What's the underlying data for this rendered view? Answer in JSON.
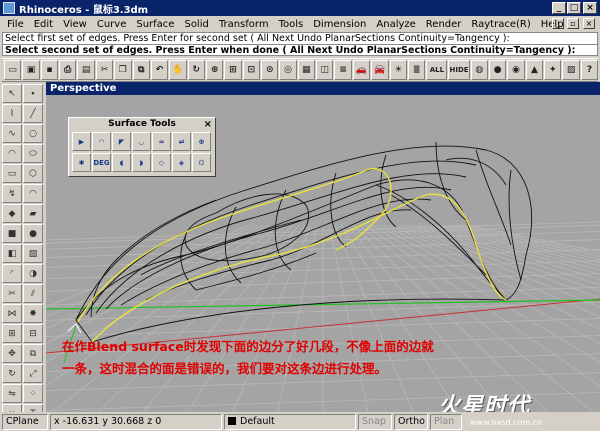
{
  "window": {
    "title": "Rhinoceros - 鼠标3.3dm",
    "min": "_",
    "max": "□",
    "close": "×"
  },
  "menu": [
    "File",
    "Edit",
    "View",
    "Curve",
    "Surface",
    "Solid",
    "Transform",
    "Tools",
    "Dimension",
    "Analyze",
    "Render",
    "Raytrace(R)",
    "Help"
  ],
  "command": {
    "history": "Select first set of edges. Press Enter for second set ( All Next Undo PlanarSections Continuity=Tangency ):",
    "prompt": "Select second set of edges. Press Enter when done ( All Next Undo PlanarSections Continuity=Tangency ):"
  },
  "toolbar_items": [
    {
      "name": "new-icon",
      "glyph": "▭"
    },
    {
      "name": "open-icon",
      "glyph": "▣"
    },
    {
      "name": "save-icon",
      "glyph": "▪"
    },
    {
      "name": "print-icon",
      "glyph": "⎙"
    },
    {
      "name": "paste-icon",
      "glyph": "▤"
    },
    {
      "name": "cut-icon",
      "glyph": "✂"
    },
    {
      "name": "copy-icon",
      "glyph": "❐"
    },
    {
      "name": "copy2-icon",
      "glyph": "⧉"
    },
    {
      "name": "undo-icon",
      "glyph": "↶"
    },
    {
      "name": "pan-icon",
      "glyph": "✋"
    },
    {
      "name": "rotate-view-icon",
      "glyph": "↻"
    },
    {
      "name": "zoom-icon",
      "glyph": "⊕"
    },
    {
      "name": "zoom-window-icon",
      "glyph": "⊞"
    },
    {
      "name": "zoom-extents-icon",
      "glyph": "⊡"
    },
    {
      "name": "zoom-selected-icon",
      "glyph": "⊙"
    },
    {
      "name": "zoom-target-icon",
      "glyph": "◎"
    },
    {
      "name": "grid-icon",
      "glyph": "▦"
    },
    {
      "name": "view-cube-icon",
      "glyph": "◫"
    },
    {
      "name": "layers-icon",
      "glyph": "≡"
    },
    {
      "name": "car-icon",
      "glyph": "🚗"
    },
    {
      "name": "car-red-icon",
      "glyph": "🚘"
    },
    {
      "name": "light-icon",
      "glyph": "☀"
    },
    {
      "name": "object-props-icon",
      "glyph": "≣"
    },
    {
      "name": "show-all-icon",
      "glyph": "ALL"
    },
    {
      "name": "hide-icon",
      "glyph": "HIDE"
    },
    {
      "name": "color-wheel-icon",
      "glyph": "◍"
    },
    {
      "name": "sphere-gray-icon",
      "glyph": "●"
    },
    {
      "name": "sphere-shaded-icon",
      "glyph": "◉"
    },
    {
      "name": "cone-blue-icon",
      "glyph": "▲"
    },
    {
      "name": "render-icon",
      "glyph": "✦"
    },
    {
      "name": "options-icon",
      "glyph": "▨"
    },
    {
      "name": "help-icon",
      "glyph": "?"
    }
  ],
  "left_tools": [
    {
      "name": "select-arrow-icon",
      "glyph": "↖"
    },
    {
      "name": "point-icon",
      "glyph": "∙"
    },
    {
      "name": "polyline-icon",
      "glyph": "⌇"
    },
    {
      "name": "line-icon",
      "glyph": "╱"
    },
    {
      "name": "curve-icon",
      "glyph": "∿"
    },
    {
      "name": "circle-icon",
      "glyph": "○"
    },
    {
      "name": "arc-icon",
      "glyph": "◠"
    },
    {
      "name": "ellipse-icon",
      "glyph": "⬭"
    },
    {
      "name": "rectangle-icon",
      "glyph": "▭"
    },
    {
      "name": "polygon-icon",
      "glyph": "⬡"
    },
    {
      "name": "freeform-icon",
      "glyph": "↯"
    },
    {
      "name": "offset-icon",
      "glyph": "◠"
    },
    {
      "name": "surface-icon",
      "glyph": "◆"
    },
    {
      "name": "extrude-icon",
      "glyph": "▰"
    },
    {
      "name": "box-icon",
      "glyph": "■"
    },
    {
      "name": "sphere-icon",
      "glyph": "●"
    },
    {
      "name": "cylinder-icon",
      "glyph": "◧"
    },
    {
      "name": "mesh-icon",
      "glyph": "▧"
    },
    {
      "name": "fillet-icon",
      "glyph": "◜"
    },
    {
      "name": "boolean-icon",
      "glyph": "◑"
    },
    {
      "name": "trim-icon",
      "glyph": "✂"
    },
    {
      "name": "split-icon",
      "glyph": "⫽"
    },
    {
      "name": "join-icon",
      "glyph": "⋈"
    },
    {
      "name": "explode-icon",
      "glyph": "✸"
    },
    {
      "name": "group-icon",
      "glyph": "⊞"
    },
    {
      "name": "ungroup-icon",
      "glyph": "⊟"
    },
    {
      "name": "move-icon",
      "glyph": "✥"
    },
    {
      "name": "copy-move-icon",
      "glyph": "⧉"
    },
    {
      "name": "rotate-icon",
      "glyph": "↻"
    },
    {
      "name": "scale-icon",
      "glyph": "⤢"
    },
    {
      "name": "mirror-icon",
      "glyph": "⇋"
    },
    {
      "name": "array-icon",
      "glyph": "⁘"
    },
    {
      "name": "dimension-icon",
      "glyph": "↔"
    },
    {
      "name": "text-icon",
      "glyph": "T"
    },
    {
      "name": "properties-icon",
      "glyph": "≣"
    },
    {
      "name": "analyze-icon",
      "glyph": "⌖"
    }
  ],
  "viewport": {
    "title": "Perspective"
  },
  "surface_tools": {
    "title": "Surface Tools",
    "close": "×",
    "row1": [
      {
        "name": "extend-surface-icon",
        "glyph": "▶"
      },
      {
        "name": "fillet-surface-icon",
        "glyph": "◠"
      },
      {
        "name": "chamfer-surface-icon",
        "glyph": "◤"
      },
      {
        "name": "offset-surface-icon",
        "glyph": "◡"
      },
      {
        "name": "blend-surface-icon",
        "glyph": "≈"
      },
      {
        "name": "match-surface-icon",
        "glyph": "⇌"
      },
      {
        "name": "merge-surface-icon",
        "glyph": "⊕"
      }
    ],
    "row2": [
      {
        "name": "rebuild-surface-icon",
        "glyph": "✱"
      },
      {
        "name": "change-degree-icon",
        "glyph": "DEG"
      },
      {
        "name": "unroll-icon",
        "glyph": "◖"
      },
      {
        "name": "shrink-icon",
        "glyph": "◗"
      },
      {
        "name": "untrim-icon",
        "glyph": "◇"
      },
      {
        "name": "split-surface-icon",
        "glyph": "◈"
      },
      {
        "name": "edge-tools-icon",
        "glyph": "⌬"
      }
    ]
  },
  "annotation": {
    "line1": "在作Blend surface时发现下面的边分了好几段，不像上面的边就",
    "line2": "一条，这时混合的面是错误的，我们要对这条边进行处理。"
  },
  "watermark": {
    "logo": "火星时代",
    "url": "www.hxsd.com.cn"
  },
  "statusbar": {
    "cplane": "CPlane",
    "coords": "x -16.631  y 30.668  z 0",
    "layer": "Default",
    "snap": "Snap",
    "ortho": "Ortho",
    "planar": "Plan"
  },
  "colors": {
    "titlebar": "#0a246a",
    "viewport_bg": "#a4a4a4",
    "grid": "#b8b8b8",
    "x_axis": "#c83030",
    "y_axis": "#20c020",
    "selected_edge": "#e8e040",
    "annotation": "#e00000"
  }
}
